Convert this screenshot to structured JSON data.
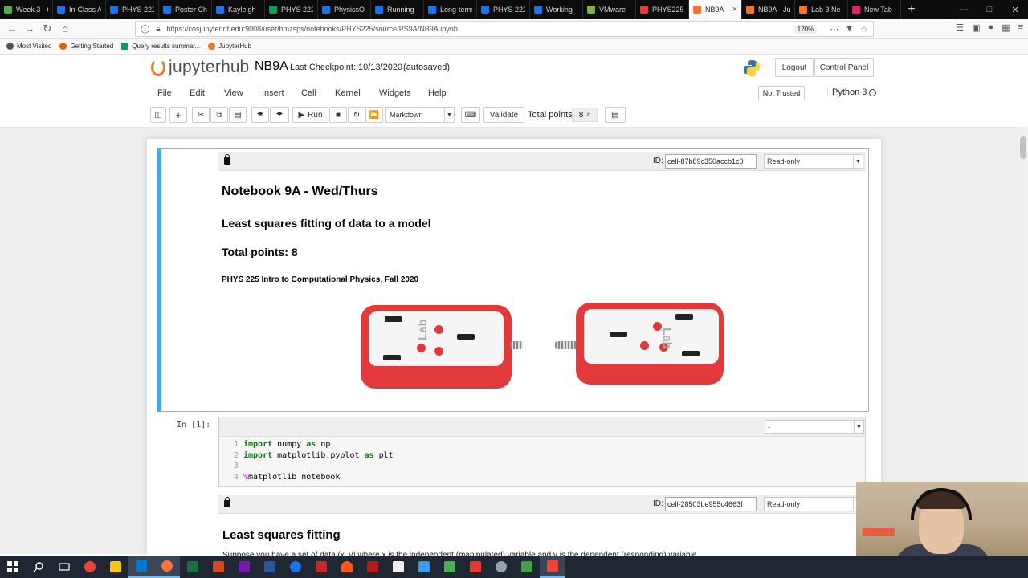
{
  "browser": {
    "tabs": [
      {
        "label": "Week 3 - C",
        "color": "#4caf50"
      },
      {
        "label": "In-Class A",
        "color": "#1a73e8"
      },
      {
        "label": "PHYS 222",
        "color": "#1a73e8"
      },
      {
        "label": "Poster Ch",
        "color": "#1a73e8"
      },
      {
        "label": "Kayleigh",
        "color": "#1a73e8"
      },
      {
        "label": "PHYS 222",
        "color": "#0f9d58"
      },
      {
        "label": "PhysicsO",
        "color": "#1a73e8"
      },
      {
        "label": "Running",
        "color": "#1a73e8"
      },
      {
        "label": "Long-term",
        "color": "#1a73e8"
      },
      {
        "label": "PHYS 222",
        "color": "#1a73e8"
      },
      {
        "label": "Working",
        "color": "#1a73e8"
      },
      {
        "label": "VMware",
        "color": "#7cb342"
      },
      {
        "label": "PHYS225",
        "color": "#e53935"
      },
      {
        "label": "NB9A",
        "color": "#f37626",
        "active": true
      },
      {
        "label": "NB9A - Ju",
        "color": "#f37626"
      },
      {
        "label": "Lab 3 Ne",
        "color": "#f37626"
      },
      {
        "label": "New Tab",
        "color": "#e91e63"
      }
    ],
    "url": "https://cosjupyter.rit.edu:9008/user/bmzsps/notebooks/PHYS225/source/PS9A/NB9A.ipynb",
    "zoom": "120%",
    "bookmarks": [
      "Most Visited",
      "Getting Started",
      "Query results summar...",
      "JupyterHub"
    ]
  },
  "jupyter": {
    "logo_text": "jupyter",
    "logo_hub": "hub",
    "notebook_name": "NB9A",
    "checkpoint": "Last Checkpoint: 10/13/2020",
    "autosaved": "(autosaved)",
    "logout": "Logout",
    "control_panel": "Control Panel",
    "menu": [
      "File",
      "Edit",
      "View",
      "Insert",
      "Cell",
      "Kernel",
      "Widgets",
      "Help"
    ],
    "not_trusted": "Not Trusted",
    "kernel": "Python 3",
    "toolbar": {
      "run": "Run",
      "cell_type": "Markdown",
      "validate": "Validate",
      "total_points_label": "Total points:",
      "total_points_value": "8"
    }
  },
  "cells": {
    "cell1": {
      "id": "cell-87b89c350accb1c0",
      "mode": "Read-only",
      "title": "Notebook 9A - Wed/Thurs",
      "subtitle": "Least squares fitting of data to a model",
      "points": "Total points: 8",
      "course": "PHYS 225 Intro to Computational Physics, Fall 2020",
      "device_logo": "Lab"
    },
    "cell2": {
      "prompt": "In [1]:",
      "mode": "-",
      "lines": [
        {
          "num": "1",
          "kw": "import",
          "rest1": " numpy ",
          "kw2": "as",
          "rest2": " np"
        },
        {
          "num": "2",
          "kw": "import",
          "rest1": " matplotlib.pyplot ",
          "kw2": "as",
          "rest2": " plt"
        },
        {
          "num": "3"
        },
        {
          "num": "4",
          "magic": "%",
          "text": "matplotlib notebook"
        }
      ]
    },
    "cell3": {
      "id": "cell-28503be955c4663f",
      "mode": "Read-only",
      "title": "Least squares fitting",
      "text": "Suppose you have a set of data (x, y) where x is the independent (manipulated) variable and y is the dependent (responding) variable."
    }
  }
}
